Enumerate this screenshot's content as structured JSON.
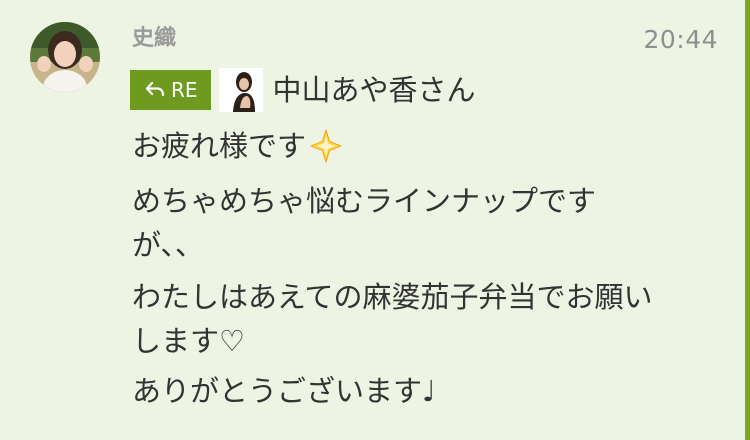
{
  "message": {
    "sender": "史織",
    "time": "20:44",
    "reply": {
      "badge_label": "RE",
      "name": "中山あや香さん"
    },
    "greeting": "お疲れ様です",
    "lines": [
      "めちゃめちゃ悩むラインナップです\nが、、",
      "わたしはあえての麻婆茄子弁当でお願い\nします♡",
      "ありがとうございます♩"
    ],
    "icons": {
      "reply_arrow": "reply-arrow-icon",
      "sparkle": "sparkle-emoji-icon"
    }
  },
  "colors": {
    "background": "#eef4e4",
    "re_badge": "#6d9a1f",
    "accent_edge": "#77a62b",
    "sender_name": "#9a9a9a",
    "timestamp": "#8f8f8f",
    "text": "#333333"
  }
}
